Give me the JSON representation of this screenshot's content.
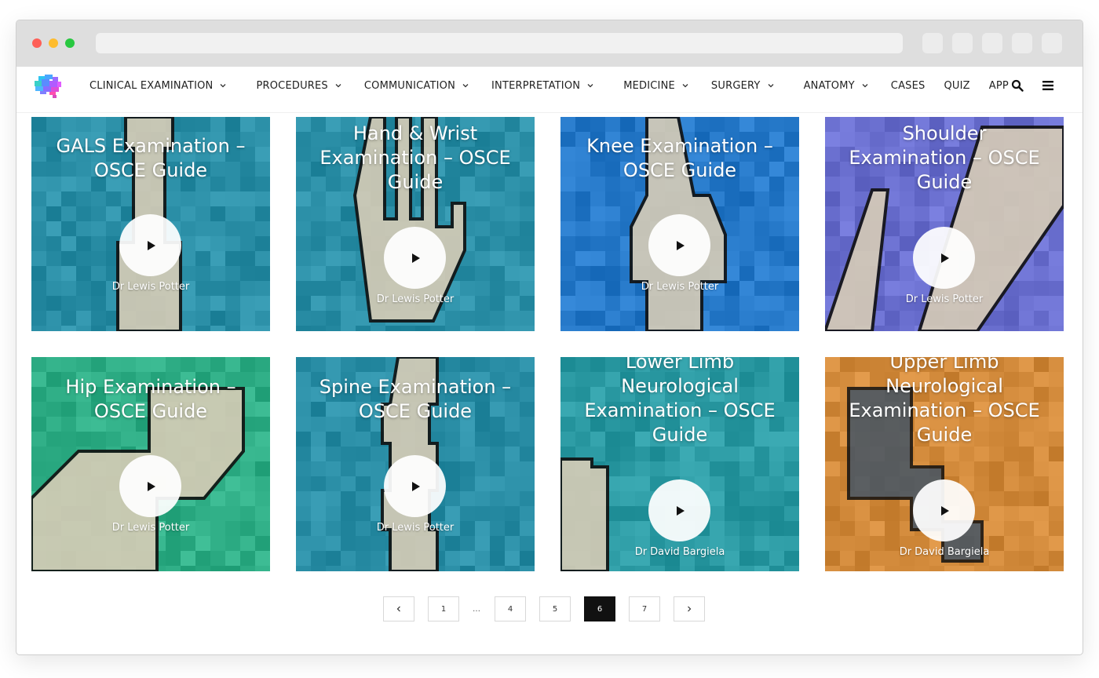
{
  "nav": {
    "items": [
      {
        "label": "CLINICAL EXAMINATION",
        "dropdown": true
      },
      {
        "label": "PROCEDURES",
        "dropdown": true
      },
      {
        "label": "COMMUNICATION",
        "dropdown": true
      },
      {
        "label": "INTERPRETATION",
        "dropdown": true
      },
      {
        "label": "MEDICINE",
        "dropdown": true
      },
      {
        "label": "SURGERY",
        "dropdown": true
      },
      {
        "label": "ANATOMY",
        "dropdown": true
      },
      {
        "label": "CASES",
        "dropdown": false
      },
      {
        "label": "QUIZ",
        "dropdown": false
      },
      {
        "label": "APP",
        "dropdown": false
      }
    ],
    "icons": [
      "search-icon",
      "hamburger-menu-icon"
    ]
  },
  "cards": [
    {
      "title": "GALS Examination – OSCE Guide",
      "author": "Dr Lewis Potter",
      "color": "#2a8ea6"
    },
    {
      "title": "Hand & Wrist Examination – OSCE Guide",
      "author": "Dr Lewis Potter",
      "color": "#2a8ea6"
    },
    {
      "title": "Knee Examination – OSCE Guide",
      "author": "Dr Lewis Potter",
      "color": "#2578c8"
    },
    {
      "title": "Shoulder Examination – OSCE Guide",
      "author": "Dr Lewis Potter",
      "color": "#6a6fcf"
    },
    {
      "title": "Hip Examination – OSCE Guide",
      "author": "Dr Lewis Potter",
      "color": "#2fae86"
    },
    {
      "title": "Spine Examination – OSCE Guide",
      "author": "Dr Lewis Potter",
      "color": "#2a8ea6"
    },
    {
      "title": "Lower Limb Neurological Examination – OSCE Guide",
      "author": "Dr David Bargiela",
      "color": "#2b9aa3"
    },
    {
      "title": "Upper Limb Neurological Examination – OSCE Guide",
      "author": "Dr David Bargiela",
      "color": "#d28a3b"
    }
  ],
  "pagination": {
    "prev_icon": "chevron-left-icon",
    "next_icon": "chevron-right-icon",
    "pages": [
      "1",
      "…",
      "4",
      "5",
      "6",
      "7"
    ],
    "current": "6"
  }
}
